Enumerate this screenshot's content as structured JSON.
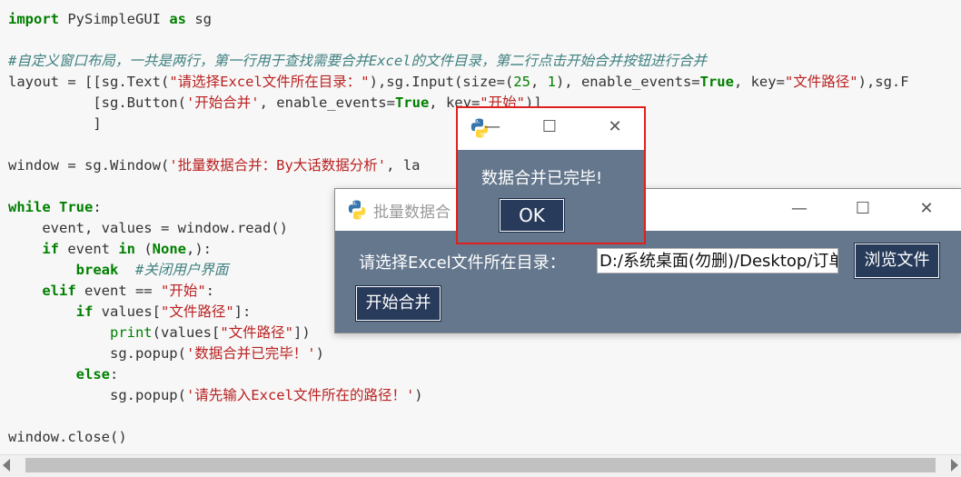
{
  "editor": {
    "lines": [
      [
        {
          "t": "import",
          "c": "kw"
        },
        {
          "t": " PySimpleGUI "
        },
        {
          "t": "as",
          "c": "kw"
        },
        {
          "t": " sg"
        }
      ],
      [],
      [
        {
          "t": "#自定义窗口布局，一共是两行，第一行用于查找需要合并Excel的文件目录，第二行点击开始合并按钮进行合并",
          "c": "cm"
        }
      ],
      [
        {
          "t": "layout = [[sg.Text("
        },
        {
          "t": "\"请选择Excel文件所在目录：\"",
          "c": "st"
        },
        {
          "t": "),sg.Input(size=("
        },
        {
          "t": "25",
          "c": "nm"
        },
        {
          "t": ", "
        },
        {
          "t": "1",
          "c": "nm"
        },
        {
          "t": "), enable_events="
        },
        {
          "t": "True",
          "c": "kw"
        },
        {
          "t": ", key="
        },
        {
          "t": "\"文件路径\"",
          "c": "st"
        },
        {
          "t": "),sg.F"
        }
      ],
      [
        {
          "t": "          [sg.Button("
        },
        {
          "t": "'开始合并'",
          "c": "st"
        },
        {
          "t": ", enable_events="
        },
        {
          "t": "True",
          "c": "kw"
        },
        {
          "t": ", key="
        },
        {
          "t": "\"开始\"",
          "c": "st"
        },
        {
          "t": ")]"
        }
      ],
      [
        {
          "t": "          ]"
        }
      ],
      [],
      [
        {
          "t": "window = sg.Window("
        },
        {
          "t": "'批量数据合并：By大话数据分析'",
          "c": "st"
        },
        {
          "t": ", la"
        }
      ],
      [],
      [
        {
          "t": "while",
          "c": "kw"
        },
        {
          "t": " "
        },
        {
          "t": "True",
          "c": "kw"
        },
        {
          "t": ":"
        }
      ],
      [
        {
          "t": "    event, values = window.read()"
        }
      ],
      [
        {
          "t": "    "
        },
        {
          "t": "if",
          "c": "kw"
        },
        {
          "t": " event "
        },
        {
          "t": "in",
          "c": "kw"
        },
        {
          "t": " ("
        },
        {
          "t": "None",
          "c": "kw"
        },
        {
          "t": ",):"
        }
      ],
      [
        {
          "t": "        "
        },
        {
          "t": "break",
          "c": "kw"
        },
        {
          "t": "  "
        },
        {
          "t": "#关闭用户界面",
          "c": "cm"
        }
      ],
      [
        {
          "t": "    "
        },
        {
          "t": "elif",
          "c": "kw"
        },
        {
          "t": " event == "
        },
        {
          "t": "\"开始\"",
          "c": "st"
        },
        {
          "t": ":"
        }
      ],
      [
        {
          "t": "        "
        },
        {
          "t": "if",
          "c": "kw"
        },
        {
          "t": " values["
        },
        {
          "t": "\"文件路径\"",
          "c": "st"
        },
        {
          "t": "]:"
        }
      ],
      [
        {
          "t": "            "
        },
        {
          "t": "print",
          "c": "fn"
        },
        {
          "t": "(values["
        },
        {
          "t": "\"文件路径\"",
          "c": "st"
        },
        {
          "t": "])"
        }
      ],
      [
        {
          "t": "            sg.popup("
        },
        {
          "t": "'数据合并已完毕！'",
          "c": "st"
        },
        {
          "t": ")"
        }
      ],
      [
        {
          "t": "        "
        },
        {
          "t": "else",
          "c": "kw"
        },
        {
          "t": ":"
        }
      ],
      [
        {
          "t": "            sg.popup("
        },
        {
          "t": "'请先输入Excel文件所在的路径！'",
          "c": "st"
        },
        {
          "t": ")"
        }
      ],
      [],
      [
        {
          "t": "window.close()"
        }
      ]
    ]
  },
  "main_window": {
    "title": "批量数据合",
    "label": "请选择Excel文件所在目录：",
    "path_value": "D:/系统桌面(勿删)/Desktop/订单",
    "browse_label": "浏览文件",
    "merge_label": "开始合并",
    "minimize_glyph": "—",
    "maximize_glyph": "☐",
    "close_glyph": "✕"
  },
  "popup": {
    "message": "数据合并已完毕!",
    "ok_label": "OK",
    "minimize_glyph": "—",
    "maximize_glyph": "☐",
    "close_glyph": "✕"
  },
  "icons": {
    "python": "python-logo-icon"
  }
}
